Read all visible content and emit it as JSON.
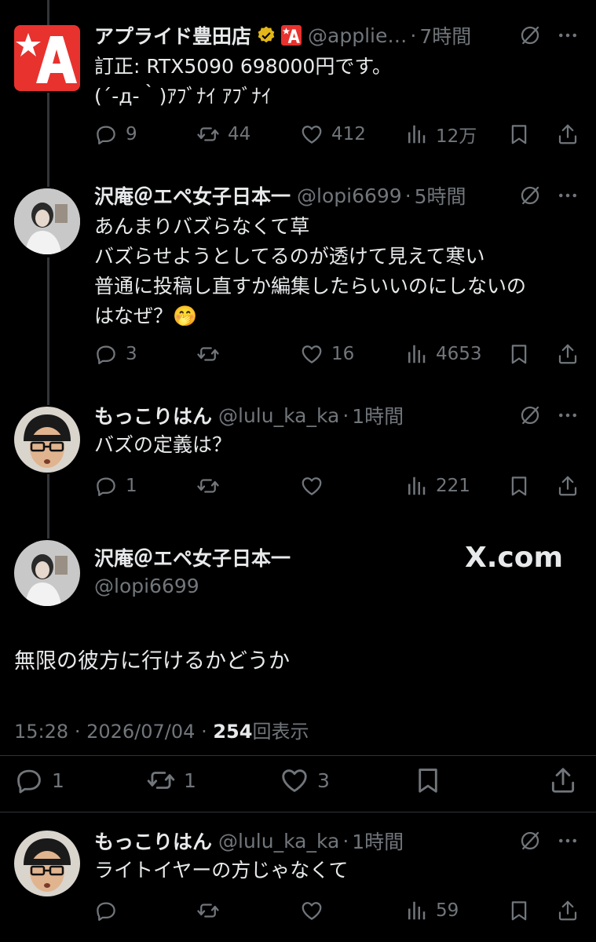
{
  "tweets": [
    {
      "name": "アプライド豊田店",
      "handle": "@applie…",
      "time": "7時間",
      "text": "訂正: RTX5090 698000円です。\n(´-д-｀)ｱﾌﾞﾅｲ ｱﾌﾞﾅｲ",
      "replies": "9",
      "retweets": "44",
      "likes": "412",
      "views": "12万"
    },
    {
      "name": "沢庵＠エペ女子日本一",
      "handle": "@lopi6699",
      "time": "5時間",
      "text": "あんまりバズらなくて草\nバズらせようとしてるのが透けて見えて寒い\n普通に投稿し直すか編集したらいいのにしないの\nはなぜ？🤭",
      "replies": "3",
      "retweets": "",
      "likes": "16",
      "views": "4653"
    },
    {
      "name": "もっこりはん",
      "handle": "@lulu_ka_ka",
      "time": "1時間",
      "text": "バズの定義は？",
      "replies": "1",
      "retweets": "",
      "likes": "",
      "views": "221"
    }
  ],
  "focused": {
    "name": "沢庵＠エペ女子日本一",
    "handle": "@lopi6699",
    "text": "無限の彼方に行けるかどうか",
    "time": "15:28",
    "date": "2026/07/04",
    "views_count": "254",
    "views_label": "回表示",
    "replies": "1",
    "retweets": "1",
    "likes": "3",
    "watermark": "X.com"
  },
  "reply": {
    "name": "もっこりはん",
    "handle": "@lulu_ka_ka",
    "time": "1時間",
    "text": "ライトイヤーの方じゃなくて",
    "replies": "",
    "retweets": "",
    "likes": "",
    "views": "59"
  },
  "separator": "·",
  "colors": {
    "background": "#000000",
    "text": "#e7e9ea",
    "muted": "#71767b",
    "brand_red": "#e8322e",
    "verified_gold": "#e2b719"
  }
}
